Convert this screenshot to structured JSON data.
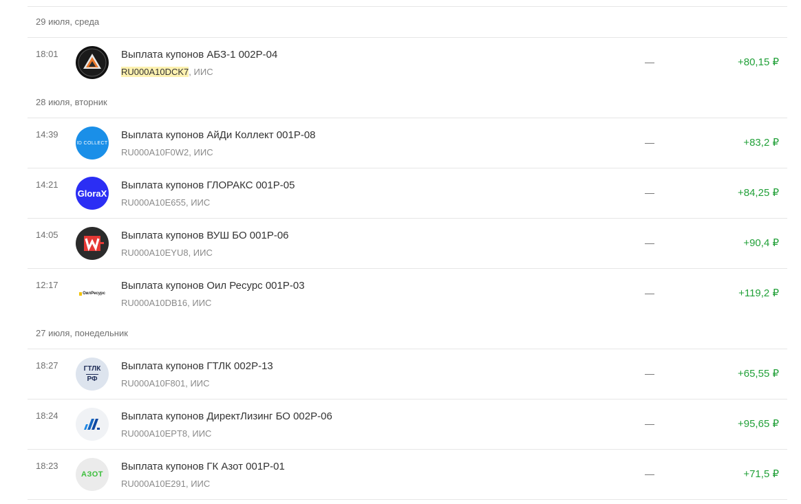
{
  "groups": [
    {
      "date": "29 июля, среда",
      "ops": [
        {
          "time": "18:01",
          "title": "Выплата купонов АБЗ-1 002P-04",
          "isin": "RU000A10DCK7",
          "account": ", ИИС",
          "dash": "—",
          "amount": "+80,15 ₽",
          "logo": "abz-1-logo-icon"
        }
      ]
    },
    {
      "date": "28 июля, вторник",
      "ops": [
        {
          "time": "14:39",
          "title": "Выплата купонов АйДи Коллект 001P-08",
          "isin": "RU000A10F0W2",
          "account": ", ИИС",
          "dash": "—",
          "amount": "+83,2 ₽",
          "logo": "id-collect-logo-icon",
          "logo_text": "ID COLLECT"
        },
        {
          "time": "14:21",
          "title": "Выплата купонов ГЛОРАКС 001Р-05",
          "isin": "RU000A10E655",
          "account": ", ИИС",
          "dash": "—",
          "amount": "+84,25 ₽",
          "logo": "glorax-logo-icon",
          "logo_text": "GloraX"
        },
        {
          "time": "14:05",
          "title": "Выплата купонов ВУШ БО 001P-06",
          "isin": "RU000A10EYU8",
          "account": ", ИИС",
          "dash": "—",
          "amount": "+90,4 ₽",
          "logo": "whoosh-logo-icon"
        },
        {
          "time": "12:17",
          "title": "Выплата купонов Оил Ресурс 001P-03",
          "isin": "RU000A10DB16",
          "account": ", ИИС",
          "dash": "—",
          "amount": "+119,2 ₽",
          "logo": "oil-resurs-logo-icon",
          "logo_text": "ОилРесурс"
        }
      ]
    },
    {
      "date": "27 июля, понедельник",
      "ops": [
        {
          "time": "18:27",
          "title": "Выплата купонов ГТЛК 002Р-13",
          "isin": "RU000A10F801",
          "account": ", ИИС",
          "dash": "—",
          "amount": "+65,55 ₽",
          "logo": "gtlk-logo-icon",
          "logo_text_1": "ГТЛК",
          "logo_text_2": "РФ"
        },
        {
          "time": "18:24",
          "title": "Выплата купонов ДиректЛизинг БО 002P-06",
          "isin": "RU000A10EPT8",
          "account": ", ИИС",
          "dash": "—",
          "amount": "+95,65 ₽",
          "logo": "direct-leasing-logo-icon"
        },
        {
          "time": "18:23",
          "title": "Выплата купонов ГК Азот 001P-01",
          "isin": "RU000A10E291",
          "account": ", ИИС",
          "dash": "—",
          "amount": "+71,5 ₽",
          "logo": "azot-logo-icon",
          "logo_text": "АЗОТ"
        }
      ]
    }
  ],
  "colors": {
    "positive_amount": "#21a038",
    "highlight": "#fdf1b0"
  }
}
